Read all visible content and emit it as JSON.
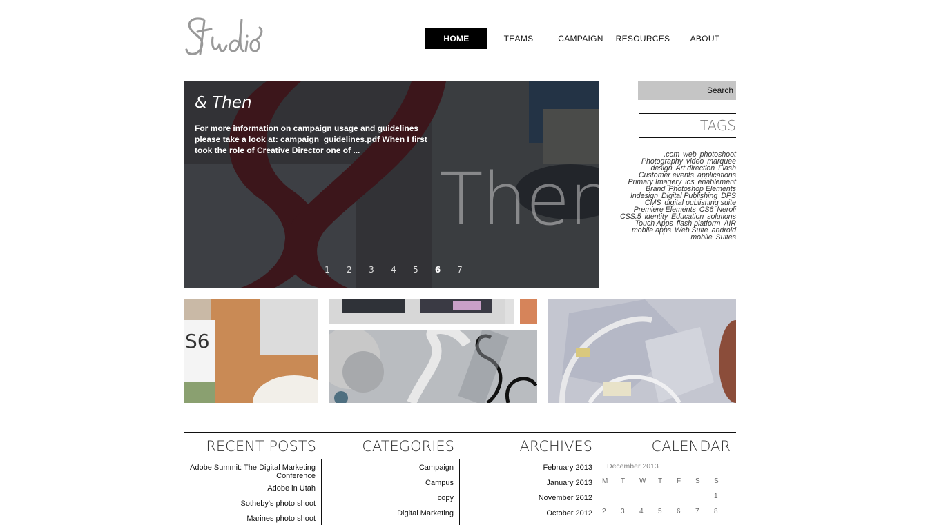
{
  "nav": {
    "items": [
      {
        "label": "HOME",
        "active": true
      },
      {
        "label": "TEAMS",
        "active": false
      },
      {
        "label": "CAMPAIGN",
        "active": false
      },
      {
        "label": "RESOURCES",
        "active": false
      },
      {
        "label": "ABOUT",
        "active": false
      }
    ]
  },
  "hero": {
    "title": "& Then",
    "excerpt": "For more information on campaign usage and guidelines please take a look at: campaign_guidelines.pdf When I first took the role of Creative Director one of ...",
    "big_text": "Then",
    "pages": [
      "1",
      "2",
      "3",
      "4",
      "5",
      "6",
      "7"
    ],
    "current_page": "6"
  },
  "search": {
    "label": "Search"
  },
  "tags": {
    "heading": "TAGS",
    "items": [
      ".com",
      "web",
      "photoshoot",
      "Photography",
      "video",
      "marquee",
      "design",
      "Art direction",
      "Flash",
      "Customer events",
      "applications",
      "Primary Imagery",
      "ios",
      "enablement",
      "Brand",
      "Photoshop Elements",
      "Indesign",
      "Digital Publishing",
      "DPS",
      "CMS",
      "digital publishing suite",
      "Premiere Elements",
      "CS6",
      "Neroli",
      "CSS.5",
      "identity",
      "Education",
      "solutions",
      "Touch Apps",
      "flash platform",
      "AIR",
      "mobile apps",
      "Web Suite",
      "android",
      "mobile",
      "Suites"
    ]
  },
  "footer": {
    "recent_posts": {
      "heading": "RECENT POSTS",
      "items": [
        "Adobe Summit: The Digital Marketing Conference",
        "Adobe in Utah",
        "Sotheby's photo shoot",
        "Marines photo shoot"
      ]
    },
    "categories": {
      "heading": "CATEGORIES",
      "items": [
        "Campaign",
        "Campus",
        "copy",
        "Digital Marketing"
      ]
    },
    "archives": {
      "heading": "ARCHIVES",
      "items": [
        "February 2013",
        "January 2013",
        "November 2012",
        "October 2012"
      ]
    },
    "calendar": {
      "heading": "CALENDAR",
      "month": "December 2013",
      "weekdays": [
        "M",
        "T",
        "W",
        "T",
        "F",
        "S",
        "S"
      ],
      "row1": [
        "",
        "",
        "",
        "",
        "",
        "",
        "1"
      ],
      "row2": [
        "2",
        "3",
        "4",
        "5",
        "6",
        "7",
        "8"
      ]
    }
  },
  "colors": {
    "accent": "#000000",
    "hero_ampersand": "#5a1a22",
    "search_bg": "#c5c5c5"
  }
}
